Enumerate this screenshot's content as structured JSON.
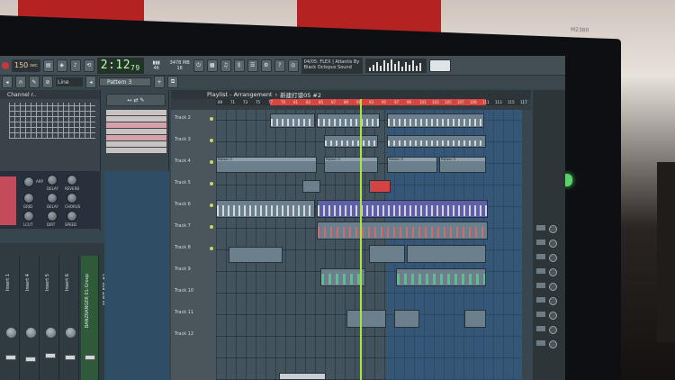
{
  "toolbar": {
    "tempo": "150",
    "tempo_unit": "sec",
    "time": "2:12",
    "time_sub": "79",
    "cpu": "46",
    "mem": "3478 MB",
    "voices": "16",
    "song_info_line1": "04/05: FLEX | Atlantis By",
    "song_info_line2": "Black Octopus Sound"
  },
  "toolbar2": {
    "line_label": "Line",
    "pattern_label": "Pattern 3"
  },
  "channel_rack": {
    "title": "Channel r..",
    "knobs": [
      "ARP",
      "DELAY",
      "REVERB",
      "GRID",
      "DELAY",
      "CHORUS",
      "LCUT",
      "DIRT",
      "SPEED"
    ]
  },
  "mixer": {
    "strips": [
      "Insert 1",
      "Insert 4",
      "Insert 5",
      "Insert 6",
      "BANZRANGER 01-Group",
      "NI BIT 80S #2"
    ]
  },
  "playlist": {
    "title": "Playlist - Arrangement",
    "breadcrumb": "新建打谱05 #2",
    "ruler_numbers": [
      "69",
      "71",
      "73",
      "75",
      "77",
      "79",
      "81",
      "83",
      "85",
      "87",
      "89",
      "91",
      "93",
      "95",
      "97",
      "99",
      "101",
      "103",
      "105",
      "107",
      "109",
      "111",
      "113",
      "115",
      "117"
    ],
    "tracks": [
      "Track 2",
      "Track 3",
      "Track 4",
      "Track 5",
      "Track 6",
      "Track 7",
      "Track 8",
      "Track 9",
      "Track 10",
      "Track 11",
      "Track 12"
    ],
    "clip_labels": [
      "Pattern 5",
      "Pattern 5",
      "Pattern 5",
      "Pattern 3"
    ]
  },
  "monitor": {
    "brand": "M2380"
  },
  "colors": {
    "ruler_red": "#d9443f",
    "playhead": "#a8e63c",
    "clock": "#b8ffb3"
  }
}
